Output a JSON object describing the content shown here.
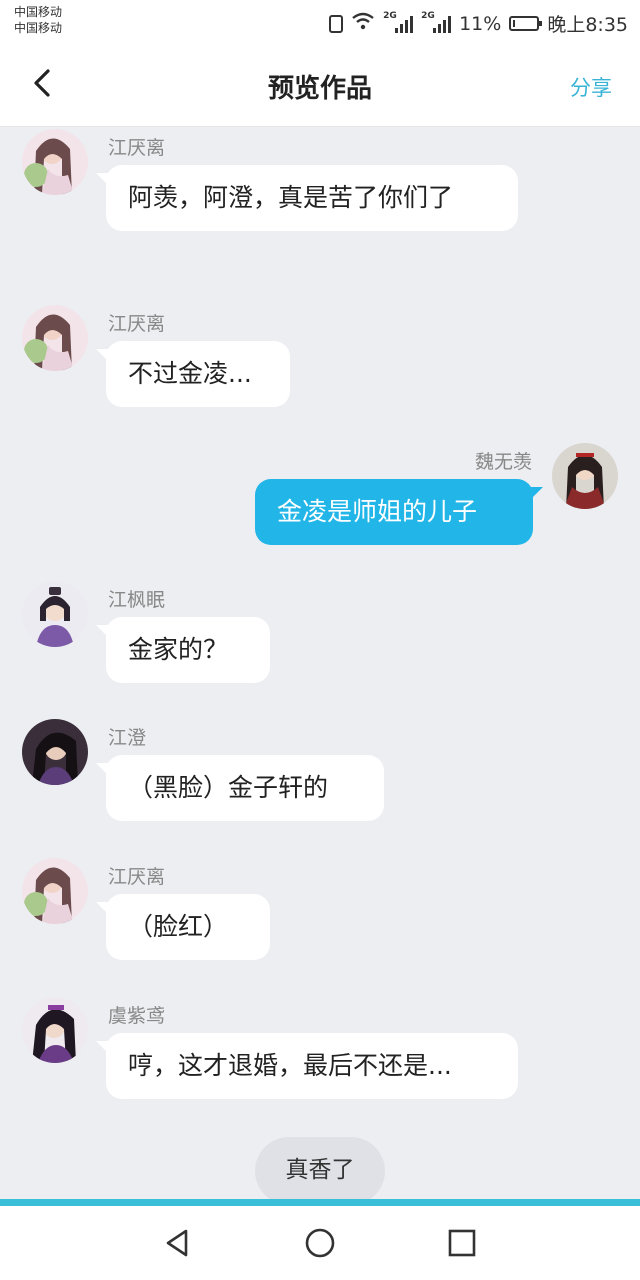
{
  "status_bar": {
    "carrier_1": "中国移动",
    "carrier_2": "中国移动",
    "sig_tag_1": "2G",
    "sig_tag_2": "2G",
    "battery": "11%",
    "time": "晚上8:35",
    "battery_level": 0.11
  },
  "header": {
    "back_icon": "chevron-left-icon",
    "title": "预览作品",
    "share_label": "分享"
  },
  "messages": [
    {
      "side": "left",
      "name": "江厌离",
      "text": "阿羡，阿澄，真是苦了你们了",
      "avatar": "avatar-jiang-yanli"
    },
    {
      "side": "left",
      "name": "江厌离",
      "text": "不过金凌...",
      "avatar": "avatar-jiang-yanli"
    },
    {
      "side": "right",
      "name": "魏无羡",
      "text": "金凌是师姐的儿子",
      "avatar": "avatar-wei-wuxian"
    },
    {
      "side": "left",
      "name": "江枫眠",
      "text": "金家的？",
      "avatar": "avatar-jiang-fengmian"
    },
    {
      "side": "left",
      "name": "江澄",
      "text": "（黑脸）金子轩的",
      "avatar": "avatar-jiang-cheng"
    },
    {
      "side": "left",
      "name": "江厌离",
      "text": "（脸红）",
      "avatar": "avatar-jiang-yanli"
    },
    {
      "side": "left",
      "name": "虞紫鸢",
      "text": "哼，这才退婚，最后不还是...",
      "avatar": "avatar-yu-ziyuan"
    }
  ],
  "footer_chip": "真香了",
  "colors": {
    "accent": "#3ab4d6",
    "bubble_right": "#22b6e8",
    "chat_bg": "#edeef2"
  },
  "system_nav": {
    "back_icon": "triangle-back-icon",
    "home_icon": "circle-home-icon",
    "recents_icon": "square-recents-icon"
  }
}
